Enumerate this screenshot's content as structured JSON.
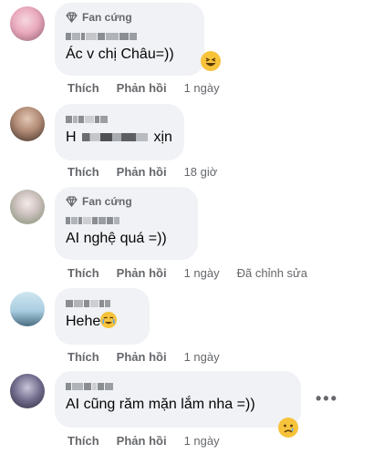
{
  "comments": [
    {
      "badge": "Fan cứng",
      "text": "Ác v chị Châu=))",
      "like": "Thích",
      "reply": "Phản hồi",
      "time": "1 ngày",
      "emoji": "laughing-emoji"
    },
    {
      "text_prefix": "H",
      "text": "xịn",
      "like": "Thích",
      "reply": "Phản hồi",
      "time": "18 giờ"
    },
    {
      "badge": "Fan cứng",
      "text": "AI nghệ quá =))",
      "like": "Thích",
      "reply": "Phản hồi",
      "time": "1 ngày",
      "edited": "Đã chỉnh sửa"
    },
    {
      "text": "Hehe",
      "like": "Thích",
      "reply": "Phản hồi",
      "time": "1 ngày",
      "emoji": "crying-emoji"
    },
    {
      "text": "AI cũng răm mặn lắm nha =))",
      "like": "Thích",
      "reply": "Phản hồi",
      "time": "1 ngày",
      "emoji": "sad-emoji",
      "more": "more-options-icon"
    }
  ],
  "colors": {
    "bubble": "#f0f2f5",
    "secondary_text": "#65676b",
    "emoji_yellow": "#f7c33b"
  }
}
